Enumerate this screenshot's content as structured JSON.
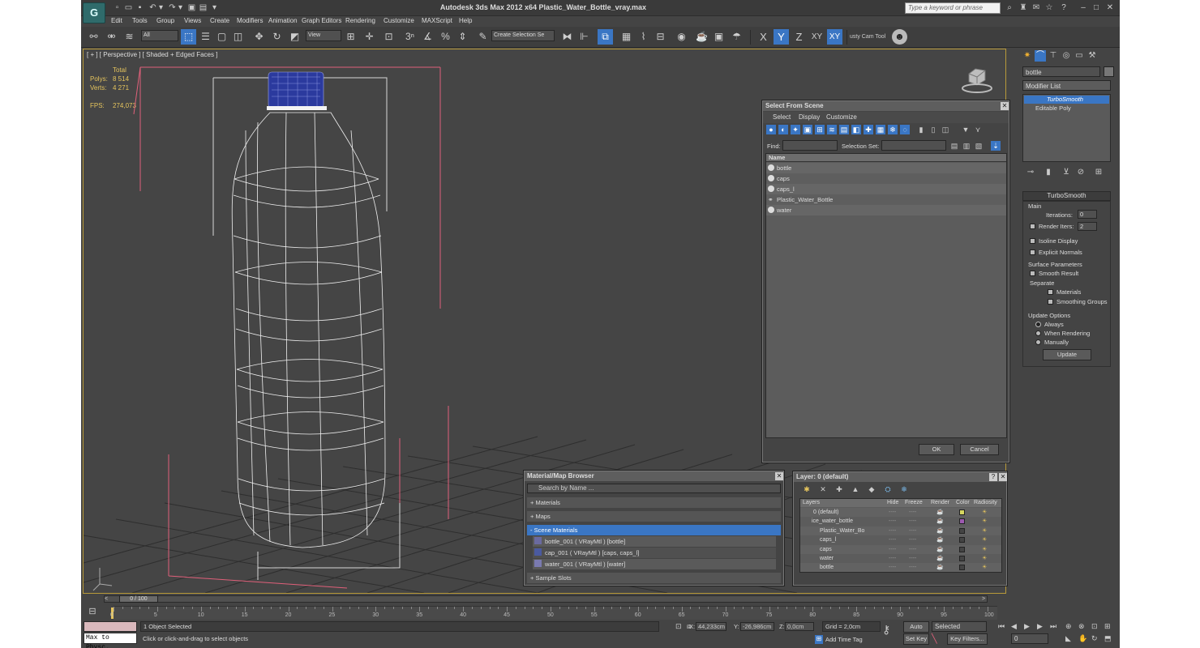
{
  "app": {
    "title": "Autodesk 3ds Max  2012 x64      Plastic_Water_Bottle_vray.max",
    "logo_icon": "3dsmax-logo-icon",
    "search_placeholder": "Type a keyword or phrase"
  },
  "menu": [
    "Edit",
    "Tools",
    "Group",
    "Views",
    "Create",
    "Modifiers",
    "Animation",
    "Graph Editors",
    "Rendering",
    "Customize",
    "MAXScript",
    "Help"
  ],
  "toolbar": {
    "filter": "All",
    "refcoord": "View",
    "selset": "Create Selection Se",
    "axes": [
      "X",
      "Y",
      "Z",
      "XY",
      "XY"
    ],
    "cam_tool": "usty Cam Tool"
  },
  "viewport": {
    "label": "[ + ] [ Perspective ] [ Shaded + Edged Faces ]",
    "stats": {
      "total_label": "Total",
      "polys_label": "Polys:",
      "polys": "8 514",
      "verts_label": "Verts:",
      "verts": "4 271",
      "fps_label": "FPS:",
      "fps": "274,073"
    },
    "bottle_cap_color": "#2b3a9e"
  },
  "select_dialog": {
    "title": "Select From Scene",
    "menus": [
      "Select",
      "Display",
      "Customize"
    ],
    "find_label": "Find:",
    "selset_label": "Selection Set:",
    "column": "Name",
    "items": [
      "bottle",
      "caps",
      "caps_l",
      "Plastic_Water_Bottle",
      "water"
    ],
    "ok": "OK",
    "cancel": "Cancel"
  },
  "material_browser": {
    "title": "Material/Map Browser",
    "search": "Search by Name ...",
    "groups": [
      "+ Materials",
      "+ Maps",
      "- Scene Materials"
    ],
    "materials": [
      "bottle_001  ( VRayMtl )  [bottle]",
      "cap_001  ( VRayMtl )  [caps, caps_l]",
      "water_001  ( VRayMtl )  [water]"
    ],
    "sample_slots": "+ Sample Slots"
  },
  "layer_dialog": {
    "title": "Layer: 0 (default)",
    "help": "?",
    "columns": [
      "Layers",
      "Hide",
      "Freeze",
      "Render",
      "Color",
      "Radiosity"
    ],
    "rows": [
      "0 (default)",
      "ice_water_bottle",
      "Plastic_Water_Bo",
      "caps_l",
      "caps",
      "water",
      "bottle"
    ],
    "dash": "----"
  },
  "command_panel": {
    "name_field": "bottle",
    "modifier_list": "Modifier List",
    "stack": [
      "TurboSmooth",
      "Editable Poly"
    ],
    "rollout": "TurboSmooth",
    "main": "Main",
    "iterations_label": "Iterations:",
    "iterations": "0",
    "render_iters_label": "Render Iters:",
    "render_iters": "2",
    "isoline": "Isoline Display",
    "explicit": "Explicit Normals",
    "surface_params": "Surface Parameters",
    "smooth_result": "Smooth Result",
    "separate": "Separate",
    "materials": "Materials",
    "smoothing_groups": "Smoothing Groups",
    "update_options": "Update Options",
    "always": "Always",
    "when_rendering": "When Rendering",
    "manually": "Manually",
    "update": "Update"
  },
  "timeline": {
    "frame": "0 / 100",
    "ticks": [
      "0",
      "5",
      "10",
      "15",
      "20",
      "25",
      "30",
      "35",
      "40",
      "45",
      "50",
      "55",
      "60",
      "65",
      "70",
      "75",
      "80",
      "85",
      "90",
      "95",
      "100"
    ]
  },
  "statusbar": {
    "maxscript": "Max to Physc.",
    "selected": "1 Object Selected",
    "prompt": "Click or click-and-drag to select objects",
    "x_label": "X:",
    "x": "44,233cm",
    "y_label": "Y:",
    "y": "-26,986cm",
    "z_label": "Z:",
    "z": "0,0cm",
    "grid": "Grid = 2,0cm",
    "add_time_tag": "Add Time Tag",
    "auto_key": "Auto Key",
    "set_key": "Set Key",
    "key_mode": "Selected",
    "key_filters": "Key Filters...",
    "current_frame": "0"
  }
}
